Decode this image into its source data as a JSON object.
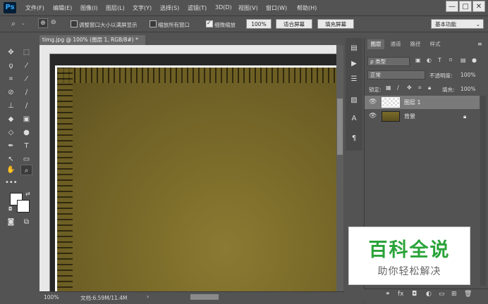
{
  "app": {
    "logo": "Ps"
  },
  "menu": [
    "文件(F)",
    "编辑(E)",
    "图像(I)",
    "图层(L)",
    "文字(Y)",
    "选择(S)",
    "滤镜(T)",
    "3D(D)",
    "视图(V)",
    "窗口(W)",
    "帮助(H)"
  ],
  "window_controls": {
    "minimize": "—",
    "maximize": "□",
    "close": "✕"
  },
  "options": {
    "zoom_tool_icon": "zoom-icon",
    "resize_windows_label": "调整窗口大小以满屏显示",
    "zoom_all_windows_label": "缩放所有窗口",
    "scrubby_zoom_label": "细微缩放",
    "zoom_value": "100%",
    "fit_screen_label": "适合屏幕",
    "fill_screen_label": "填充屏幕",
    "workspace": "基本功能",
    "resize_windows_checked": false,
    "zoom_all_windows_checked": false,
    "scrubby_zoom_checked": true
  },
  "document": {
    "tab_title": "timg.jpg @ 100% (图层 1, RGB/8#) *",
    "tab_close": "×",
    "status_zoom": "100%",
    "status_doc": "文档:6.59M/11.4M",
    "status_arrow": "›"
  },
  "panel": {
    "tabs": [
      "图层",
      "通道",
      "路径",
      "样式"
    ],
    "filter_kind": "ρ 类型",
    "blend_mode": "正常",
    "opacity_label": "不透明度:",
    "opacity_value": "100%",
    "lock_label": "锁定:",
    "fill_label": "填充:",
    "fill_value": "100%",
    "layers": [
      {
        "name": "图层 1",
        "selected": true,
        "locked": false
      },
      {
        "name": "背景",
        "selected": false,
        "locked": true
      }
    ]
  },
  "watermark": {
    "title": "百科全说",
    "subtitle": "助你轻松解决"
  },
  "colors": {
    "chrome_bg": "#535353",
    "canvas_bg": "#282828",
    "watermark_green": "#2aa339"
  }
}
